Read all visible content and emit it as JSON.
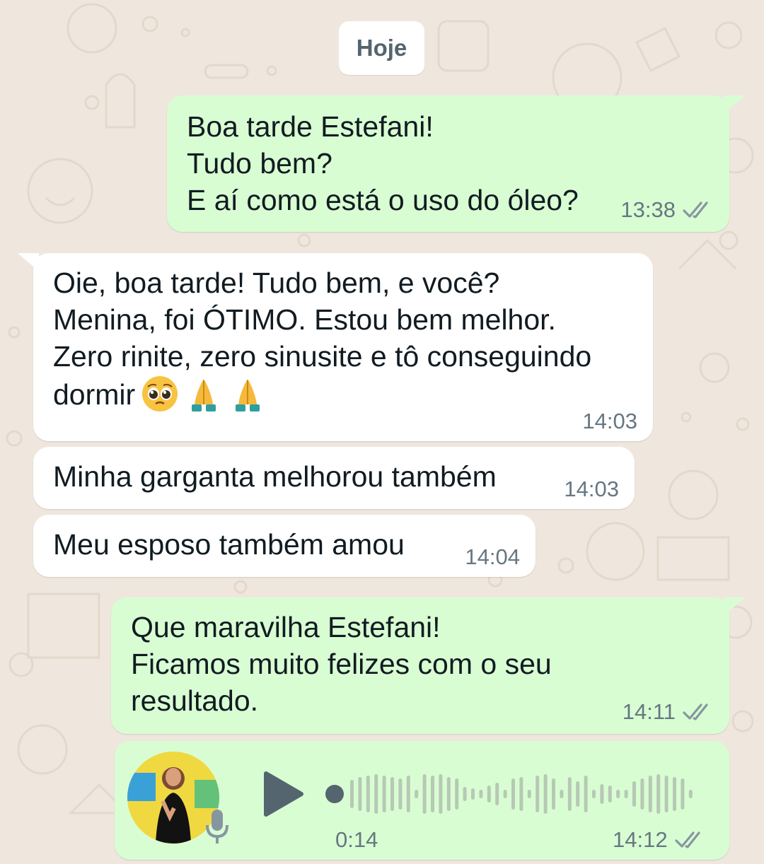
{
  "date_separator": "Hoje",
  "colors": {
    "background": "#efe7de",
    "outgoing_bubble": "#d9fdd3",
    "incoming_bubble": "#ffffff",
    "meta_text": "#667781",
    "read_ticks": "#8696a0"
  },
  "messages": [
    {
      "direction": "outgoing",
      "text": "Boa tarde Estefani!\nTudo bem?\nE aí como está o uso do óleo?",
      "time": "13:38",
      "status": "delivered"
    },
    {
      "direction": "incoming",
      "text": "Oie, boa tarde! Tudo bem, e você?\nMenina, foi ÓTIMO. Estou bem melhor.\nZero rinite, zero sinusite e tô conseguindo\ndormir",
      "emojis": [
        "pleading-face",
        "folded-hands",
        "folded-hands"
      ],
      "time": "14:03"
    },
    {
      "direction": "incoming",
      "text": "Minha garganta melhorou também",
      "time": "14:03"
    },
    {
      "direction": "incoming",
      "text": "Meu esposo também amou",
      "time": "14:04"
    },
    {
      "direction": "outgoing",
      "text": "Que maravilha Estefani!\nFicamos muito felizes com o seu\nresultado.",
      "time": "14:11",
      "status": "delivered"
    },
    {
      "direction": "outgoing",
      "type": "voice",
      "duration": "0:14",
      "time": "14:12",
      "status": "delivered",
      "progress": 0
    }
  ]
}
